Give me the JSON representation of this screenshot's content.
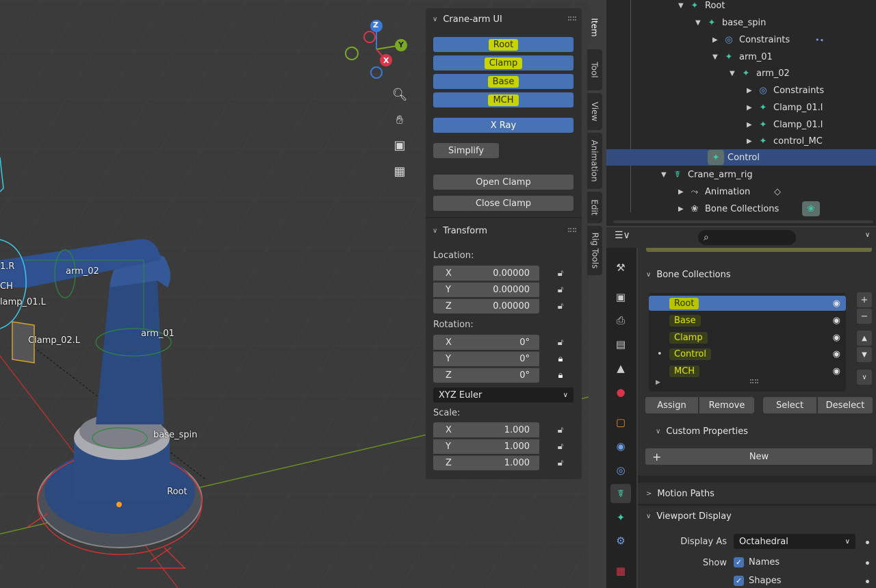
{
  "viewport": {
    "labels": [
      "1.R",
      "CH",
      "lamp_01.L",
      "arm_02",
      "Clamp_02.L",
      "arm_01",
      "base_spin",
      "Root"
    ],
    "gizmo": {
      "z": "Z",
      "y": "Y",
      "x": "X"
    }
  },
  "npanel": {
    "crane_ui_title": "Crane-arm UI",
    "layer_buttons": [
      "Root",
      "Clamp",
      "Base",
      "MCH"
    ],
    "xray": "X Ray",
    "simplify": "Simplify",
    "open_clamp": "Open Clamp",
    "close_clamp": "Close Clamp",
    "transform_title": "Transform",
    "location_label": "Location:",
    "location": [
      {
        "axis": "X",
        "value": "0.00000"
      },
      {
        "axis": "Y",
        "value": "0.00000"
      },
      {
        "axis": "Z",
        "value": "0.00000"
      }
    ],
    "rotation_label": "Rotation:",
    "rotation": [
      {
        "axis": "X",
        "value": "0°"
      },
      {
        "axis": "Y",
        "value": "0°"
      },
      {
        "axis": "Z",
        "value": "0°"
      }
    ],
    "rotation_mode": "XYZ Euler",
    "scale_label": "Scale:",
    "scale": [
      {
        "axis": "X",
        "value": "1.000"
      },
      {
        "axis": "Y",
        "value": "1.000"
      },
      {
        "axis": "Z",
        "value": "1.000"
      }
    ]
  },
  "vtabs": [
    "Item",
    "Tool",
    "View",
    "Animation",
    "Edit",
    "Rig Tools"
  ],
  "outliner": {
    "rows": [
      "Root",
      "base_spin",
      "Constraints",
      "arm_01",
      "arm_02",
      "Constraints",
      "Clamp_01.l",
      "Clamp_01.l",
      "control_MC",
      "Control",
      "Crane_arm_rig",
      "Animation",
      "Bone Collections"
    ]
  },
  "properties": {
    "bone_collections_title": "Bone Collections",
    "collections": [
      "Root",
      "Base",
      "Clamp",
      "Control",
      "MCH"
    ],
    "assign": "Assign",
    "remove": "Remove",
    "select": "Select",
    "deselect": "Deselect",
    "custom_properties_title": "Custom Properties",
    "new": "New",
    "motion_paths_title": "Motion Paths",
    "viewport_display_title": "Viewport Display",
    "display_as_label": "Display As",
    "display_as_value": "Octahedral",
    "show_label": "Show",
    "show_names": "Names",
    "show_shapes": "Shapes"
  },
  "colors": {
    "accent": "#4772b3",
    "highlight": "#c8d400",
    "bone": "#3ec9a7"
  }
}
